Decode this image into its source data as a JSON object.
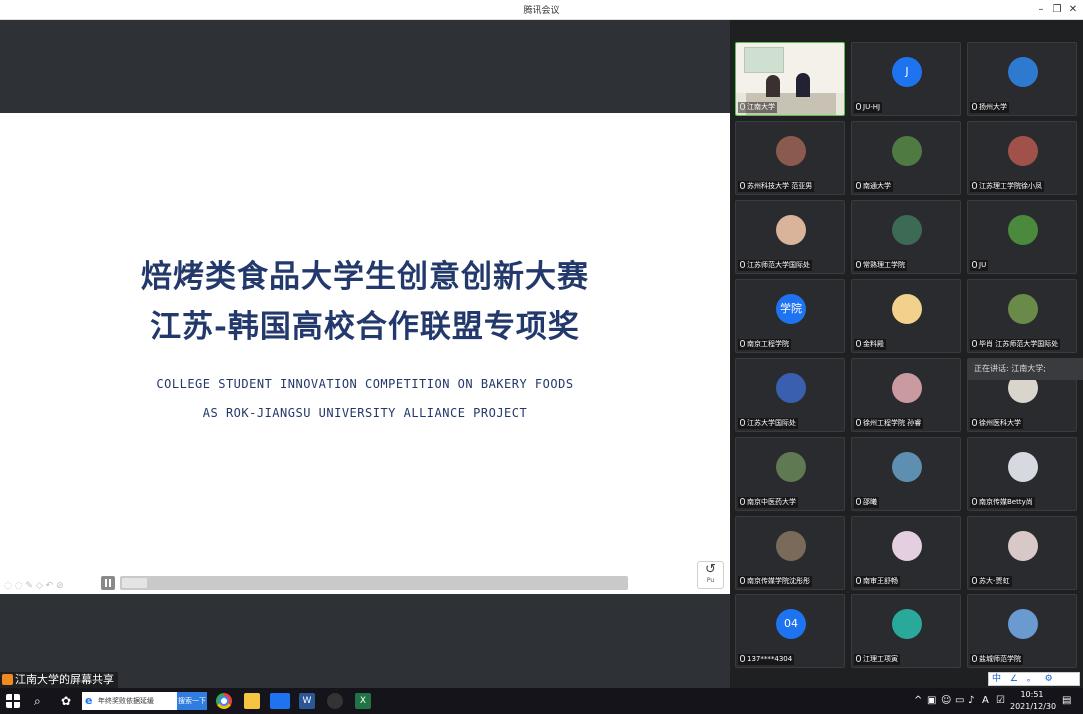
{
  "window": {
    "title": "腾讯会议"
  },
  "slide": {
    "title_line1": "焙烤类食品大学生创意创新大赛",
    "title_line2": "江苏-韩国高校合作联盟专项奖",
    "subtitle_line1": "COLLEGE STUDENT INNOVATION COMPETITION ON BAKERY FOODS",
    "subtitle_line2": "AS ROK-JIANGSU UNIVERSITY ALLIANCE PROJECT",
    "return_label": "Pu",
    "progress_fraction": 0.05
  },
  "share_label": "江南大学的屏幕共享",
  "participants": [
    {
      "name": "江南大学",
      "avatar": "video",
      "active": true
    },
    {
      "name": "JU-HJ",
      "avatar": "letter",
      "letter": "J",
      "color": "#1e74f0"
    },
    {
      "name": "扬州大学",
      "avatar": "photo",
      "color": "#2f7ad1"
    },
    {
      "name": "苏州科技大学 范亚男",
      "avatar": "photo",
      "color": "#8a5a4e"
    },
    {
      "name": "南通大学",
      "avatar": "photo",
      "color": "#4f7a42"
    },
    {
      "name": "江苏理工学院徐小凤",
      "avatar": "photo",
      "color": "#a0524a"
    },
    {
      "name": "江苏师范大学国际处",
      "avatar": "photo",
      "color": "#d9b49a"
    },
    {
      "name": "常熟理工学院",
      "avatar": "photo",
      "color": "#3d6a55"
    },
    {
      "name": "JU",
      "avatar": "photo",
      "color": "#4b8a3c"
    },
    {
      "name": "南京工程学院",
      "avatar": "letter",
      "letter": "学院",
      "color": "#1e74f0"
    },
    {
      "name": "金料殿",
      "avatar": "photo",
      "color": "#f2d28a"
    },
    {
      "name": "毕肖 江苏师范大学国际处",
      "avatar": "photo",
      "color": "#6a8a4a"
    },
    {
      "name": "江苏大学国际处",
      "avatar": "photo",
      "color": "#3a5fae"
    },
    {
      "name": "徐州工程学院 孙睿",
      "avatar": "photo",
      "color": "#c99aa0"
    },
    {
      "name": "徐州医科大学",
      "avatar": "photo",
      "color": "#d9d4cc"
    },
    {
      "name": "南京中医药大学",
      "avatar": "photo",
      "color": "#5f7a52"
    },
    {
      "name": "邵曦",
      "avatar": "photo",
      "color": "#5f8fb0"
    },
    {
      "name": "南京传媒Betty尚",
      "avatar": "photo",
      "color": "#d6d9e0"
    },
    {
      "name": "南京传媒学院沈彤彤",
      "avatar": "photo",
      "color": "#7a6a5a"
    },
    {
      "name": "南审王舒畅",
      "avatar": "photo",
      "color": "#e4cfe0"
    },
    {
      "name": "苏大-贾虹",
      "avatar": "photo",
      "color": "#d8c8c8"
    },
    {
      "name": "137****4304",
      "avatar": "letter",
      "letter": "04",
      "color": "#1e74f0"
    },
    {
      "name": "江理工项寅",
      "avatar": "photo",
      "color": "#2aa89a"
    },
    {
      "name": "盐城师范学院",
      "avatar": "photo",
      "color": "#6a9ad0"
    }
  ],
  "speaking": "正在讲话: 江南大学;",
  "ime_tray": "中 ∠ 。 ⚙",
  "taskbar": {
    "search_text": "年终奖败依据延缓",
    "search_button": "搜索一下",
    "time": "10:51",
    "date": "2021/12/30",
    "ime_label": "A"
  }
}
